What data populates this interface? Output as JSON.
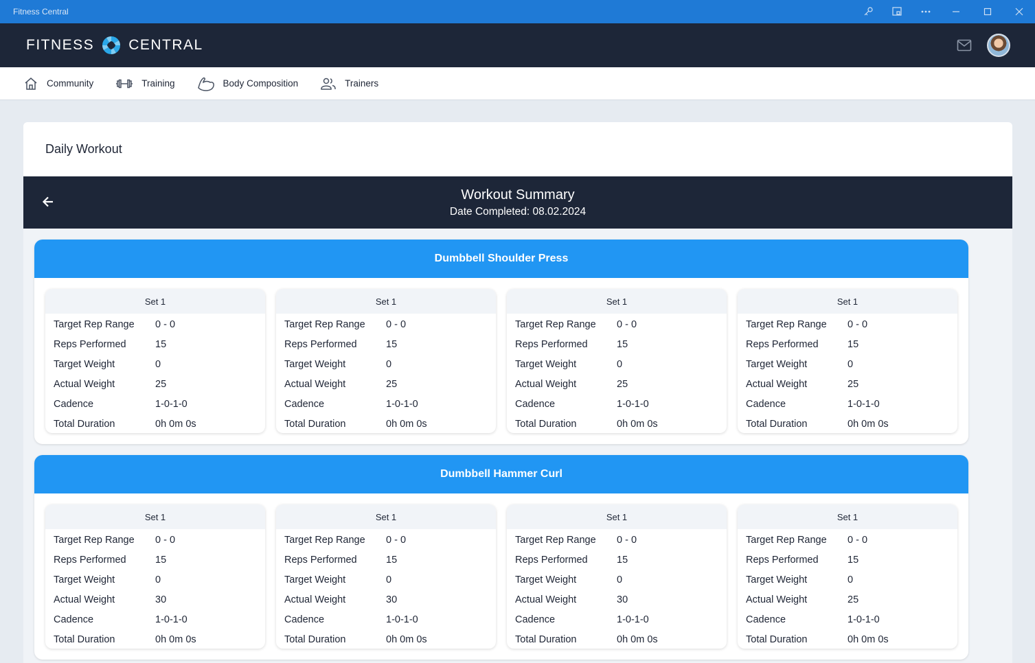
{
  "window": {
    "title": "Fitness Central"
  },
  "brand": {
    "left": "FITNESS",
    "right": "CENTRAL"
  },
  "nav": [
    {
      "label": "Community",
      "icon": "home-icon"
    },
    {
      "label": "Training",
      "icon": "dumbbell-icon"
    },
    {
      "label": "Body Composition",
      "icon": "flexed-arm-icon"
    },
    {
      "label": "Trainers",
      "icon": "people-icon"
    }
  ],
  "page": {
    "title": "Daily Workout"
  },
  "summary": {
    "title": "Workout Summary",
    "date": "Date Completed: 08.02.2024"
  },
  "labels": {
    "target_rep_range": "Target Rep Range",
    "reps_performed": "Reps Performed",
    "target_weight": "Target Weight",
    "actual_weight": "Actual Weight",
    "cadence": "Cadence",
    "total_duration": "Total Duration"
  },
  "exercises": [
    {
      "name": "Dumbbell Shoulder Press",
      "sets": [
        {
          "title": "Set 1",
          "target_rep_range": "0 - 0",
          "reps_performed": "15",
          "target_weight": "0",
          "actual_weight": "25",
          "cadence": "1-0-1-0",
          "total_duration": "0h 0m 0s"
        },
        {
          "title": "Set 1",
          "target_rep_range": "0 - 0",
          "reps_performed": "15",
          "target_weight": "0",
          "actual_weight": "25",
          "cadence": "1-0-1-0",
          "total_duration": "0h 0m 0s"
        },
        {
          "title": "Set 1",
          "target_rep_range": "0 - 0",
          "reps_performed": "15",
          "target_weight": "0",
          "actual_weight": "25",
          "cadence": "1-0-1-0",
          "total_duration": "0h 0m 0s"
        },
        {
          "title": "Set 1",
          "target_rep_range": "0 - 0",
          "reps_performed": "15",
          "target_weight": "0",
          "actual_weight": "25",
          "cadence": "1-0-1-0",
          "total_duration": "0h 0m 0s"
        }
      ]
    },
    {
      "name": "Dumbbell Hammer Curl",
      "sets": [
        {
          "title": "Set 1",
          "target_rep_range": "0 - 0",
          "reps_performed": "15",
          "target_weight": "0",
          "actual_weight": "30",
          "cadence": "1-0-1-0",
          "total_duration": "0h 0m 0s"
        },
        {
          "title": "Set 1",
          "target_rep_range": "0 - 0",
          "reps_performed": "15",
          "target_weight": "0",
          "actual_weight": "30",
          "cadence": "1-0-1-0",
          "total_duration": "0h 0m 0s"
        },
        {
          "title": "Set 1",
          "target_rep_range": "0 - 0",
          "reps_performed": "15",
          "target_weight": "0",
          "actual_weight": "30",
          "cadence": "1-0-1-0",
          "total_duration": "0h 0m 0s"
        },
        {
          "title": "Set 1",
          "target_rep_range": "0 - 0",
          "reps_performed": "15",
          "target_weight": "0",
          "actual_weight": "25",
          "cadence": "1-0-1-0",
          "total_duration": "0h 0m 0s"
        }
      ]
    }
  ],
  "colors": {
    "titlebar": "#1f7ad6",
    "header": "#1d2638",
    "accent": "#2196f3",
    "background": "#e6ebf1"
  }
}
